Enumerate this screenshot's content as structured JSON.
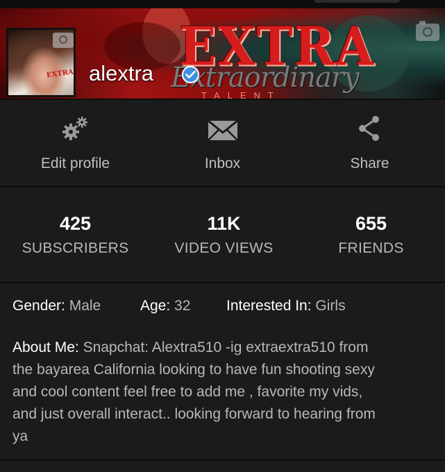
{
  "banner": {
    "brand": "EXTRA",
    "script": "Extraordinary",
    "subtitle": "TALENT",
    "camera_icon": "camera-icon"
  },
  "profile": {
    "username": "alextra",
    "verified": true,
    "avatar_label": "EXTRA",
    "avatar_camera_icon": "camera-icon"
  },
  "actions": [
    {
      "label": "Edit profile",
      "icon": "gear-icon"
    },
    {
      "label": "Inbox",
      "icon": "envelope-icon"
    },
    {
      "label": "Share",
      "icon": "share-icon"
    }
  ],
  "stats": [
    {
      "value": "425",
      "label": "SUBSCRIBERS"
    },
    {
      "value": "11K",
      "label": "VIDEO VIEWS"
    },
    {
      "value": "655",
      "label": "FRIENDS"
    }
  ],
  "details": {
    "gender_key": "Gender",
    "gender_value": "Male",
    "age_key": "Age",
    "age_value": "32",
    "interest_key": "Interested In",
    "interest_value": "Girls"
  },
  "about": {
    "key": "About Me",
    "lines": [
      "Snapchat: Alextra510 -ig extraextra510 from",
      "the bayarea California looking to have fun shooting sexy",
      "and cool content feel free to add me , favorite my vids,",
      "and just overall interact.. looking forward to hearing from",
      "ya"
    ]
  },
  "colors": {
    "background": "#1b1b1b",
    "divider": "#0c0c0c",
    "label_gray": "#b8b8b8",
    "verified_blue": "#3d8fe0",
    "brand_red": "#d61d1d"
  }
}
